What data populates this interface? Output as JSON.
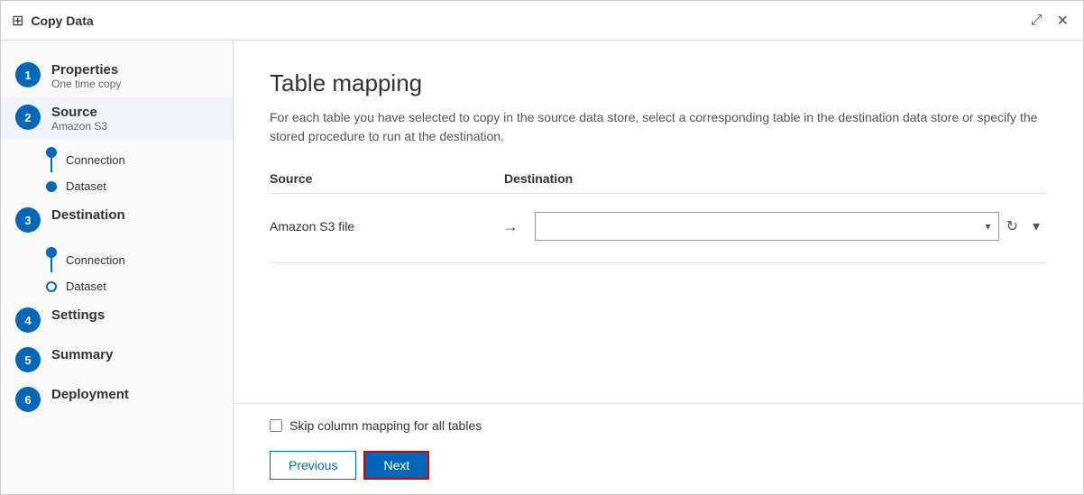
{
  "titleBar": {
    "title": "Copy Data",
    "expandIcon": "⤢",
    "closeIcon": "✕"
  },
  "sidebar": {
    "steps": [
      {
        "id": 1,
        "label": "Properties",
        "sublabel": "One time copy",
        "active": false,
        "circle": "filled"
      },
      {
        "id": 2,
        "label": "Source",
        "sublabel": "Amazon S3",
        "active": true,
        "circle": "filled",
        "subSteps": [
          {
            "label": "Connection",
            "type": "filled"
          },
          {
            "label": "Dataset",
            "type": "filled"
          }
        ]
      },
      {
        "id": 3,
        "label": "Destination",
        "sublabel": "",
        "active": false,
        "circle": "filled",
        "subSteps": [
          {
            "label": "Connection",
            "type": "filled"
          },
          {
            "label": "Dataset",
            "type": "outline"
          }
        ]
      },
      {
        "id": 4,
        "label": "Settings",
        "sublabel": "",
        "active": false,
        "circle": "filled"
      },
      {
        "id": 5,
        "label": "Summary",
        "sublabel": "",
        "active": false,
        "circle": "filled"
      },
      {
        "id": 6,
        "label": "Deployment",
        "sublabel": "",
        "active": false,
        "circle": "filled"
      }
    ]
  },
  "content": {
    "title": "Table mapping",
    "description": "For each table you have selected to copy in the source data store, select a corresponding table in the destination data store or specify the stored procedure to run at the destination.",
    "tableHeaders": {
      "source": "Source",
      "destination": "Destination"
    },
    "mappingRows": [
      {
        "sourceName": "Amazon S3 file",
        "arrow": "→",
        "destValue": "",
        "destPlaceholder": ""
      }
    ],
    "checkboxLabel": "Skip column mapping for all tables",
    "checkboxChecked": false
  },
  "buttons": {
    "previous": "Previous",
    "next": "Next"
  }
}
